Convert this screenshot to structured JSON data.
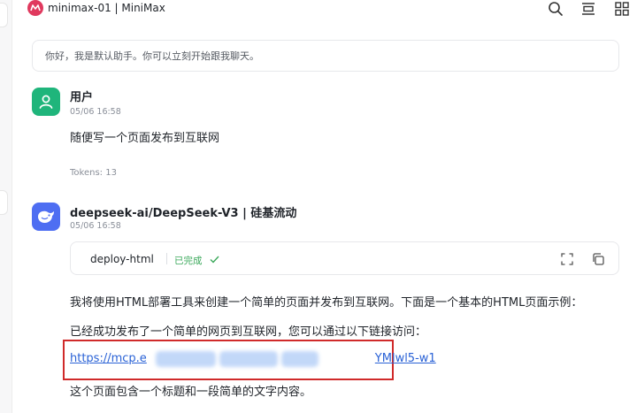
{
  "window": {
    "title": "minimax-01 | MiniMax"
  },
  "icons": {
    "search": "search-icon",
    "panel": "panel-toggle-icon",
    "grid": "grid-icon",
    "expand": "expand-icon",
    "copy": "copy-icon",
    "check": "check-icon"
  },
  "system_message": "你好，我是默认助手。你可以立刻开始跟我聊天。",
  "user_message": {
    "name": "用户",
    "time": "05/06 16:58",
    "text": "随便写一个页面发布到互联网",
    "tokens": "Tokens: 13"
  },
  "assistant_message": {
    "name": "deepseek-ai/DeepSeek-V3 | 硅基流动",
    "time": "05/06 16:58",
    "tool_call": {
      "name": "deploy-html",
      "status": "已完成"
    },
    "line1": "我将使用HTML部署工具来创建一个简单的页面并发布到互联网。下面是一个基本的HTML页面示例：",
    "line2": "已经成功发布了一个简单的网页到互联网，您可以通过以下链接访问：",
    "link_start": "https://mcp.e",
    "link_end": "YMlwl5-w1",
    "line3": "这个页面包含一个标题和一段简单的文字内容。"
  },
  "colors": {
    "user_avatar": "#1fb57b",
    "assistant_avatar": "#4e6ef2",
    "link": "#2a62d6",
    "highlight_box": "#d02a2a",
    "status": "#3aa85a"
  }
}
